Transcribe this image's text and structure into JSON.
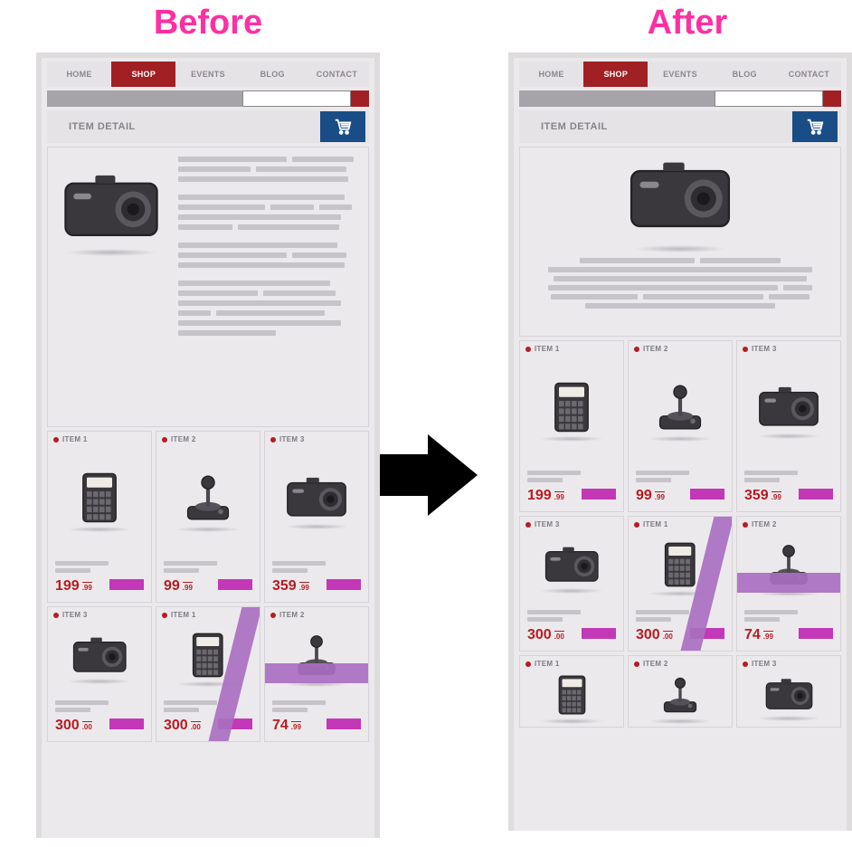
{
  "labels": {
    "before": "Before",
    "after": "After"
  },
  "nav": {
    "items": [
      "HOME",
      "SHOP",
      "EVENTS",
      "BLOG",
      "CONTACT"
    ],
    "active_index": 1
  },
  "banner": {
    "title": "ITEM DETAIL"
  },
  "before_layout": {
    "hero_side_by_side": true,
    "rows": [
      [
        {
          "title": "ITEM 1",
          "icon": "calculator",
          "price": "199",
          "cents": ".99"
        },
        {
          "title": "ITEM 2",
          "icon": "joystick",
          "price": "99",
          "cents": ".99"
        },
        {
          "title": "ITEM 3",
          "icon": "camera",
          "price": "359",
          "cents": ".99"
        }
      ],
      [
        {
          "title": "ITEM 3",
          "icon": "camera",
          "price": "300",
          "cents": ".00"
        },
        {
          "title": "ITEM 1",
          "icon": "calculator",
          "price": "300",
          "cents": ".00",
          "ribbon": true
        },
        {
          "title": "ITEM 2",
          "icon": "joystick",
          "price": "74",
          "cents": ".99",
          "ribbon_h": true
        }
      ]
    ]
  },
  "after_layout": {
    "hero_side_by_side": false,
    "rows": [
      [
        {
          "title": "ITEM 1",
          "icon": "calculator",
          "price": "199",
          "cents": ".99"
        },
        {
          "title": "ITEM 2",
          "icon": "joystick",
          "price": "99",
          "cents": ".99"
        },
        {
          "title": "ITEM 3",
          "icon": "camera",
          "price": "359",
          "cents": ".99"
        }
      ],
      [
        {
          "title": "ITEM 3",
          "icon": "camera",
          "price": "300",
          "cents": ".00"
        },
        {
          "title": "ITEM 1",
          "icon": "calculator",
          "price": "300",
          "cents": ".00",
          "ribbon": true
        },
        {
          "title": "ITEM 2",
          "icon": "joystick",
          "price": "74",
          "cents": ".99",
          "ribbon_h": true
        }
      ],
      [
        {
          "title": "ITEM 1",
          "icon": "calculator"
        },
        {
          "title": "ITEM 2",
          "icon": "joystick"
        },
        {
          "title": "ITEM 3",
          "icon": "camera"
        }
      ]
    ]
  },
  "colors": {
    "accent_red": "#a02024",
    "price_red": "#b61c23",
    "cart_blue": "#1a4d86",
    "buy_magenta": "#c238b6",
    "ribbon_purple": "#a96fc1",
    "heading_pink": "#ff2fa2"
  }
}
